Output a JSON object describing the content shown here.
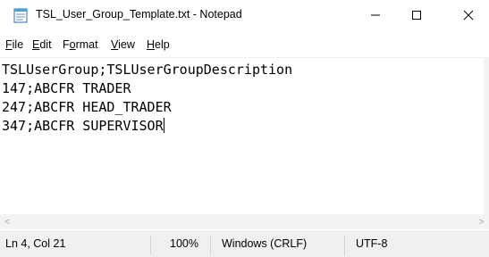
{
  "window": {
    "title": "TSL_User_Group_Template.txt - Notepad",
    "icon": "notepad-icon",
    "controls": [
      "minimize-icon",
      "maximize-icon",
      "close-icon"
    ]
  },
  "menu": [
    {
      "ul": "F",
      "rest": "ile"
    },
    {
      "ul": "E",
      "rest": "dit"
    },
    {
      "pre": "F",
      "ul": "o",
      "rest": "rmat"
    },
    {
      "ul": "V",
      "rest": "iew"
    },
    {
      "ul": "H",
      "rest": "elp"
    }
  ],
  "editor": {
    "lines": [
      "TSLUserGroup;TSLUserGroupDescription",
      "147;ABCFR TRADER",
      "247;ABCFR HEAD_TRADER",
      "347;ABCFR SUPERVISOR"
    ]
  },
  "scrollbar": {
    "left_arrow": "<",
    "right_arrow": ">"
  },
  "status": {
    "position": "Ln 4, Col 21",
    "zoom": "100%",
    "line_ending": "Windows (CRLF)",
    "encoding": "UTF-8"
  }
}
